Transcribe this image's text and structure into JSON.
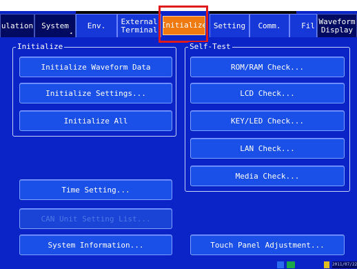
{
  "tabs": [
    {
      "label": "ulation"
    },
    {
      "label": "System"
    },
    {
      "label": "Env."
    },
    {
      "label": "External\nTerminal"
    },
    {
      "label": "Initialize"
    },
    {
      "label": "Setting"
    },
    {
      "label": "Comm."
    },
    {
      "label": "Fil"
    },
    {
      "label": "Waveform\nDisplay"
    }
  ],
  "initialize_panel": {
    "title": "Initialize",
    "buttons": {
      "waveform": "Initialize Waveform Data",
      "settings": "Initialize Settings...",
      "all": "Initialize All"
    }
  },
  "selftest_panel": {
    "title": "Self-Test",
    "buttons": {
      "romram": "ROM/RAM Check...",
      "lcd": "LCD Check...",
      "keyled": "KEY/LED Check...",
      "lan": "LAN Check...",
      "media": "Media Check..."
    }
  },
  "bottom_buttons": {
    "time": "Time Setting...",
    "can": "CAN Unit Setting List...",
    "sysinfo": "System Information...",
    "touch": "Touch Panel Adjustment..."
  },
  "status": {
    "date": "2011/07/22"
  },
  "colors": {
    "background": "#0a24c8",
    "button": "#1a4fe8",
    "selected_tab": "#f07a10",
    "highlight": "#e01a1a"
  }
}
